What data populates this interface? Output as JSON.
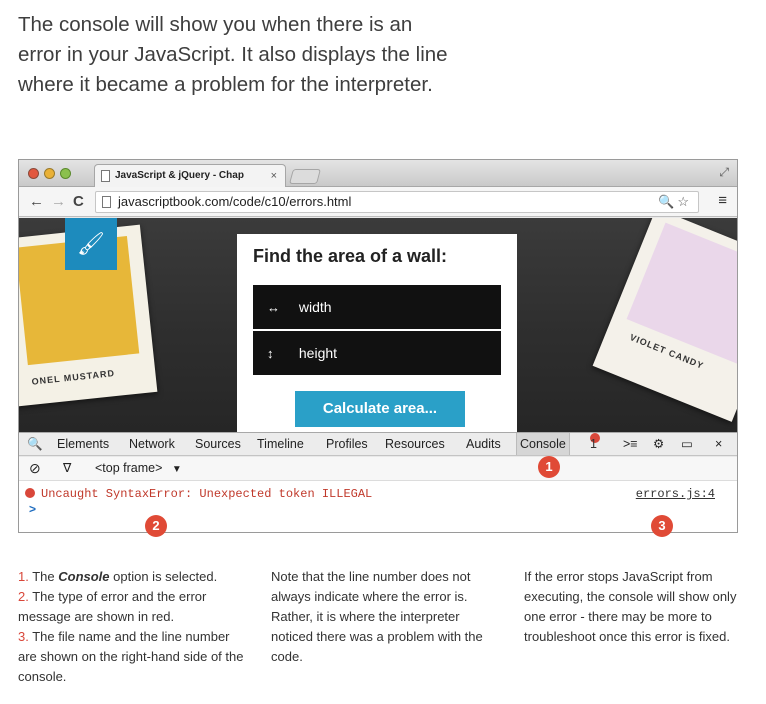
{
  "intro": {
    "line1": "The console will show you when there is an",
    "line2": "error in your JavaScript. It also displays the line",
    "line3": "where it became a problem for the interpreter."
  },
  "browser": {
    "tab_title": "JavaScript & jQuery - Chap",
    "tab_close": "×",
    "url": "javascriptbook.com/code/c10/errors.html",
    "nav_back": "←",
    "nav_forward": "→",
    "nav_reload": "C",
    "url_icons": "🔍☆",
    "menu_icon": "≡",
    "resize_icon": "⤢"
  },
  "page": {
    "yellow_card_label": "ONEL MUSTARD",
    "violet_card_label": "VIOLET CANDY",
    "brush_icon": "🖌",
    "heading": "Find the area of a wall:",
    "width_icon": "↔",
    "width_label": "width",
    "height_icon": "↕",
    "height_label": "height",
    "calc_button": "Calculate area..."
  },
  "devtools": {
    "search_icon": "🔍",
    "tabs": [
      "Elements",
      "Network",
      "Sources",
      "Timeline",
      "Profiles",
      "Resources",
      "Audits",
      "Console"
    ],
    "selected_tab": "Console",
    "error_count": "1",
    "drawer_icon": ">≡",
    "gear_icon": "⚙",
    "dock_icon": "▭",
    "close_icon": "×",
    "clear_icon": "⃠",
    "filter_icon": "∇",
    "frame_label": "<top frame>",
    "frame_arrow": "▼",
    "error_message": "Uncaught SyntaxError: Unexpected token ILLEGAL",
    "error_file": "errors.js:4",
    "prompt": ">"
  },
  "callouts": [
    "1",
    "2",
    "3"
  ],
  "notes": {
    "col1": {
      "n1": "1.",
      "t1a": " The ",
      "t1b": "Console",
      "t1c": " option is selected.",
      "n2": "2.",
      "t2": " The type of error and the error message are shown in red.",
      "n3": "3.",
      "t3": " The file name and the line number are shown on the right-hand side of the console."
    },
    "col2": "Note that the line number does not always  indicate where the error is. Rather, it is where the interpreter noticed there was a problem with the code.",
    "col3": "If the error stops JavaScript from executing, the console will show only one error - there may be more to troubleshoot once this error is fixed."
  },
  "colors": {
    "callout": "#e04a36",
    "error_text": "#c0392b",
    "button": "#2aa0c8",
    "mustard": "#e7b739",
    "violet": "#ead7ea"
  }
}
